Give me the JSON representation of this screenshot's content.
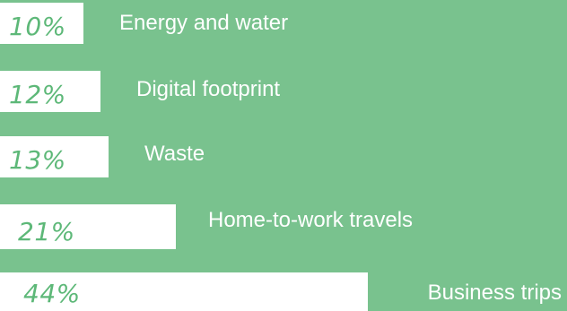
{
  "chart_data": {
    "type": "bar",
    "orientation": "horizontal",
    "categories": [
      "Energy and water",
      "Digital footprint",
      "Waste",
      "Home-to-work travels",
      "Business trips"
    ],
    "values": [
      10,
      12,
      13,
      21,
      44
    ],
    "value_labels": [
      "10%",
      "12%",
      "13%",
      "21%",
      "44%"
    ],
    "unit": "%",
    "xlim": [
      0,
      44
    ],
    "grid": false,
    "legend": "none",
    "colors": {
      "background": "#79c28e",
      "bar": "#ffffff",
      "value_text": "#5db878",
      "category_text": "#ffffff"
    }
  }
}
